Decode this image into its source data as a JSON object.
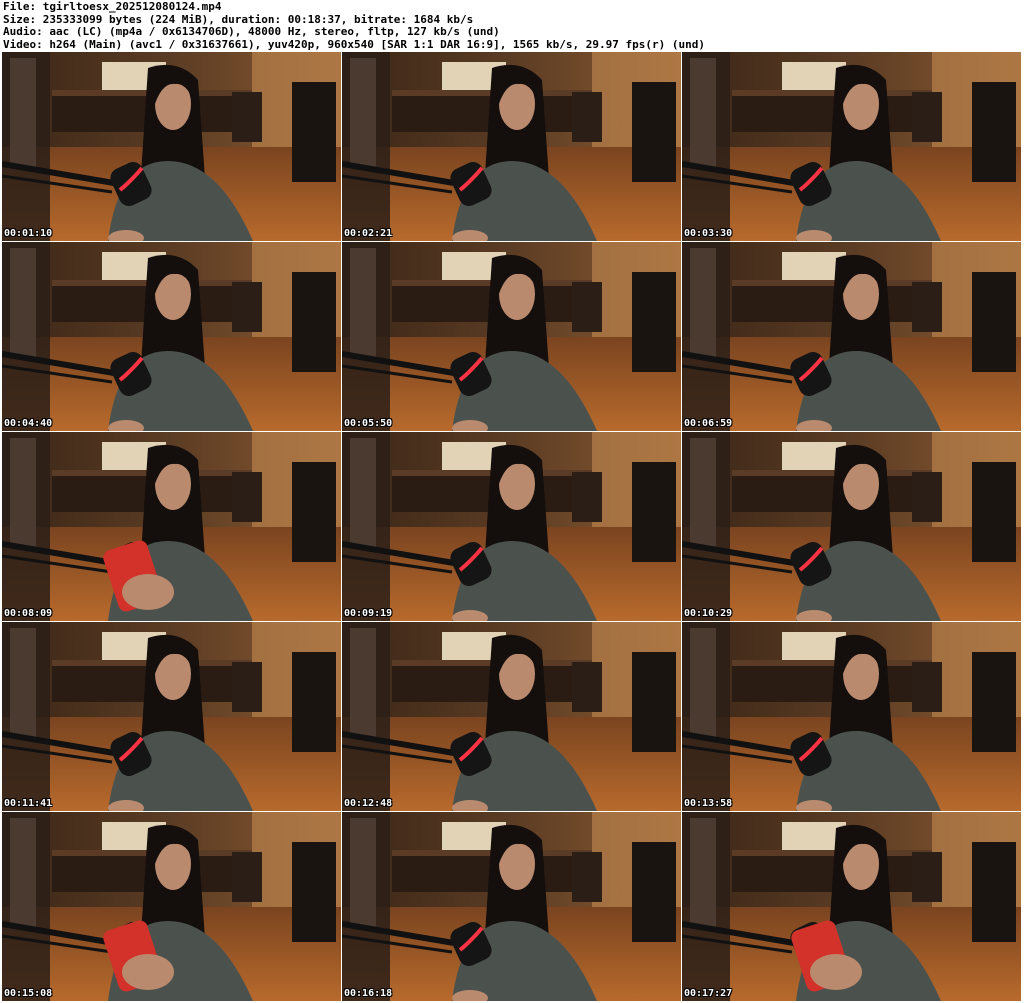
{
  "header": {
    "file_line": "File: tgirltoesx_202512080124.mp4",
    "size_line": "Size: 235333099 bytes (224 MiB), duration: 00:18:37, bitrate: 1684 kb/s",
    "audio_line": "Audio: aac (LC) (mp4a / 0x6134706D), 48000 Hz, stereo, fltp, 127 kb/s (und)",
    "video_line": "Video: h264 (Main) (avc1 / 0x31637661), yuv420p, 960x540 [SAR 1:1 DAR 16:9], 1565 kb/s, 29.97 fps(r) (und)"
  },
  "thumbnails": [
    {
      "timestamp": "00:01:10",
      "phone": false
    },
    {
      "timestamp": "00:02:21",
      "phone": false
    },
    {
      "timestamp": "00:03:30",
      "phone": false
    },
    {
      "timestamp": "00:04:40",
      "phone": false
    },
    {
      "timestamp": "00:05:50",
      "phone": false
    },
    {
      "timestamp": "00:06:59",
      "phone": false
    },
    {
      "timestamp": "00:08:09",
      "phone": true
    },
    {
      "timestamp": "00:09:19",
      "phone": false
    },
    {
      "timestamp": "00:10:29",
      "phone": false
    },
    {
      "timestamp": "00:11:41",
      "phone": false
    },
    {
      "timestamp": "00:12:48",
      "phone": false
    },
    {
      "timestamp": "00:13:58",
      "phone": false
    },
    {
      "timestamp": "00:15:08",
      "phone": true
    },
    {
      "timestamp": "00:16:18",
      "phone": false
    },
    {
      "timestamp": "00:17:27",
      "phone": true
    }
  ],
  "colors": {
    "wall": "#5b3c24",
    "floor": "#b86a2c",
    "window": "#f2e4c8",
    "hoodie": "#4b524e",
    "hair": "#140e0c",
    "skin": "#b98a6e",
    "mic_light": "#ff3344",
    "phone": "#d2322a"
  }
}
